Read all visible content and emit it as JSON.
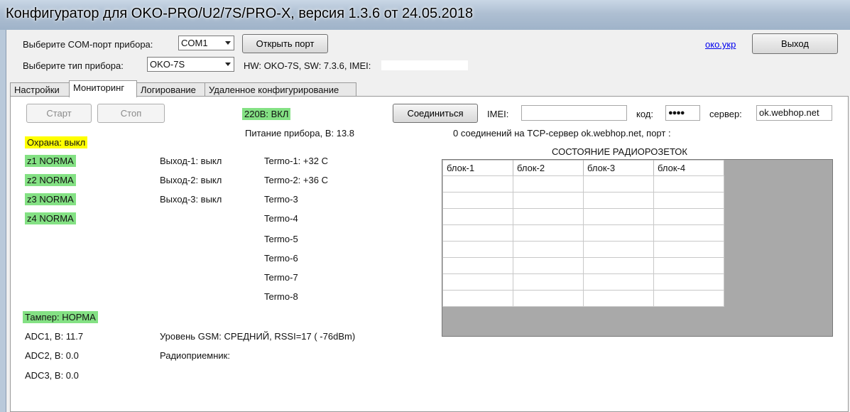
{
  "window": {
    "title": "Конфигуратор для OKO-PRO/U2/7S/PRO-X, версия 1.3.6 от 24.05.2018"
  },
  "header": {
    "com_label": "Выберите COM-порт прибора:",
    "com_value": "COM1",
    "open_port": "Открыть порт",
    "type_label": "Выберите тип прибора:",
    "type_value": "OKO-7S",
    "hw_info": "HW: OKO-7S, SW: 7.3.6, IMEI:",
    "site_link": "око.укр",
    "exit": "Выход"
  },
  "tabs": [
    "Настройки",
    "Мониторинг",
    "Логирование",
    "Удаленное конфигурирование"
  ],
  "active_tab": "Мониторинг",
  "monitor": {
    "start": "Старт",
    "stop": "Стоп",
    "power_220": "220В: ВКЛ",
    "power_supply": "Питание прибора, В: 13.8",
    "security": "Охрана: выкл",
    "zones": [
      "z1 NORMA",
      "z2 NORMA",
      "z3 NORMA",
      "z4 NORMA"
    ],
    "outputs": [
      "Выход-1: выкл",
      "Выход-2: выкл",
      "Выход-3: выкл"
    ],
    "termo": [
      "Termo-1: +32 C",
      "Termo-2: +36 C",
      "Termo-3",
      "Termo-4",
      "Termo-5",
      "Termo-6",
      "Termo-7",
      "Termo-8"
    ],
    "tamper": "Тампер: НОРМА",
    "adc": [
      "ADC1, В: 11.7",
      "ADC2, В: 0.0",
      "ADC3, В: 0.0"
    ],
    "gsm": "Уровень GSM: СРЕДНИЙ, RSSI=17 ( -76dBm)",
    "radio": "Радиоприемник:"
  },
  "connection": {
    "connect": "Соединиться",
    "imei_label": "IMEI:",
    "imei_value": "",
    "code_label": "код:",
    "code_value": "●●●●",
    "server_label": "сервер:",
    "server_value": "ok.webhop.net",
    "status": "0 соединений на TCP-сервер ok.webhop.net, порт :"
  },
  "radio_sockets": {
    "title": "СОСТОЯНИЕ РАДИОРОЗЕТОК",
    "columns": [
      "блок-1",
      "блок-2",
      "блок-3",
      "блок-4"
    ],
    "rows": [
      [
        "",
        "",
        "",
        ""
      ],
      [
        "",
        "",
        "",
        ""
      ],
      [
        "",
        "",
        "",
        ""
      ],
      [
        "",
        "",
        "",
        ""
      ],
      [
        "",
        "",
        "",
        ""
      ],
      [
        "",
        "",
        "",
        ""
      ],
      [
        "",
        "",
        "",
        ""
      ],
      [
        "",
        "",
        "",
        ""
      ]
    ]
  },
  "colors": {
    "ok_green": "#84e184",
    "warn_yellow": "#ffff00",
    "link_blue": "#0000ee"
  }
}
